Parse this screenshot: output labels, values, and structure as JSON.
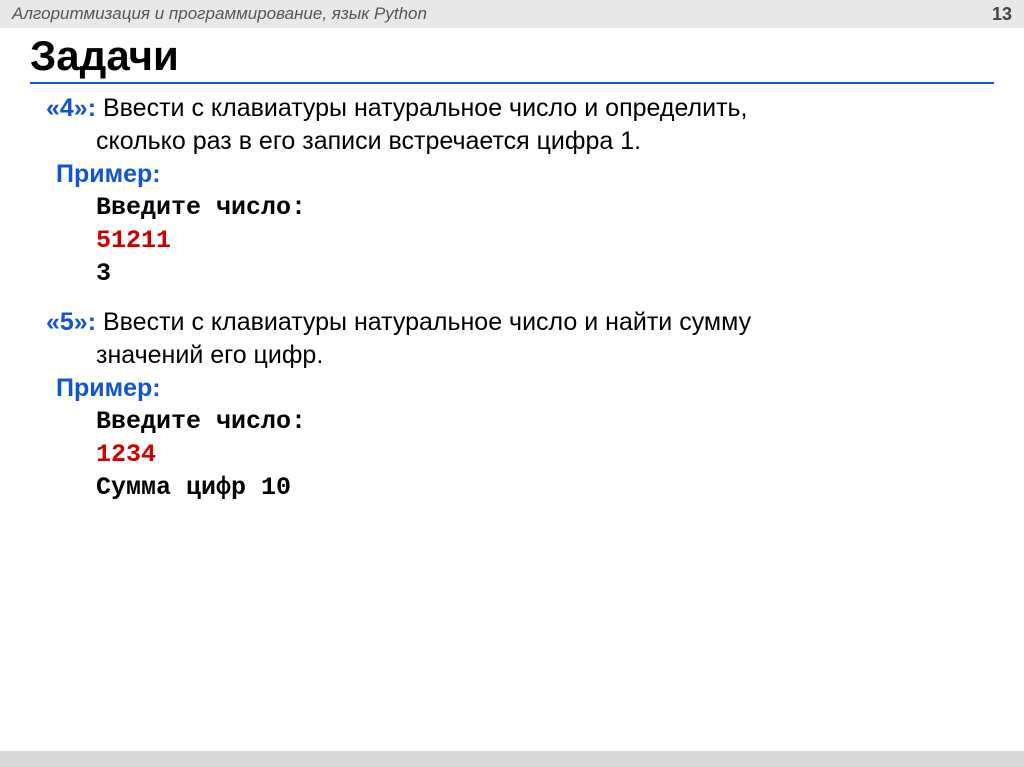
{
  "header": {
    "subject": "Алгоритмизация и программирование, язык Python",
    "page": "13"
  },
  "title": "Задачи",
  "tasks": [
    {
      "num": "«4»:",
      "line1": "Ввести с клавиатуры натуральное число и определить,",
      "line2": "сколько  раз в его записи встречается цифра 1.",
      "example_label": "Пример:",
      "code": [
        {
          "text": "Введите число:",
          "red": false
        },
        {
          "text": "51211",
          "red": true
        },
        {
          "text": "3",
          "red": false
        }
      ]
    },
    {
      "num": "«5»:",
      "line1": "Ввести с клавиатуры натуральное число и найти сумму",
      "line2": "значений его цифр.",
      "example_label": "Пример:",
      "code": [
        {
          "text": "Введите число:",
          "red": false
        },
        {
          "text": "1234",
          "red": true
        },
        {
          "text": "Сумма цифр 10",
          "red": false
        }
      ]
    }
  ]
}
